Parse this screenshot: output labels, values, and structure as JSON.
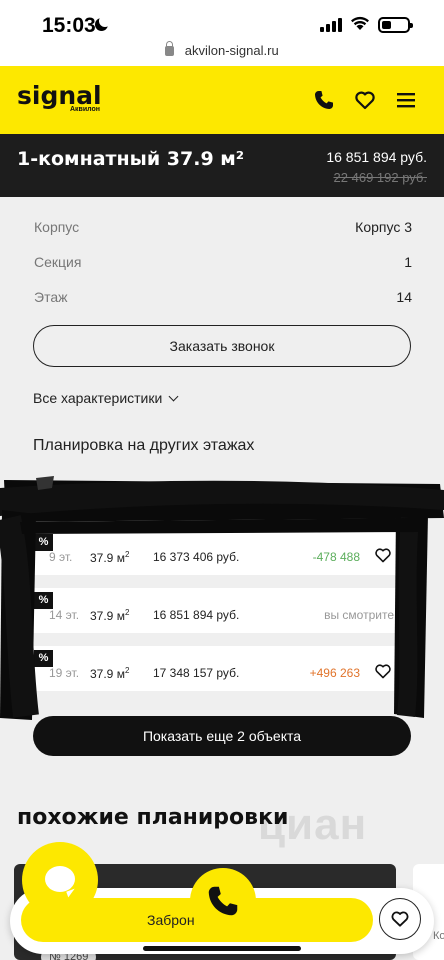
{
  "status_bar": {
    "time": "15:03"
  },
  "browser": {
    "url": "akvilon-signal.ru"
  },
  "header": {
    "logo": "signal",
    "logo_sub": "Аквилон"
  },
  "listing": {
    "title": "1-комнатный 37.9 м²",
    "price": "16 851 894 руб.",
    "old_price": "22 469 192 руб."
  },
  "properties": [
    {
      "label": "Корпус",
      "value": "Корпус 3"
    },
    {
      "label": "Секция",
      "value": "1"
    },
    {
      "label": "Этаж",
      "value": "14"
    }
  ],
  "actions": {
    "call_label": "Заказать звонок",
    "all_chars_label": "Все характеристики",
    "show_more_label": "Показать еще 2 объекта",
    "book_label": "Заброн"
  },
  "other_floors": {
    "title": "Планировка на других этажах",
    "rows": [
      {
        "floor": "9 эт.",
        "area": "37.9 м",
        "area_sup": "2",
        "price": "16 373 406 руб.",
        "diff": "-478 488",
        "diff_type": "neg",
        "badge": "%"
      },
      {
        "floor": "14 эт.",
        "area": "37.9 м",
        "area_sup": "2",
        "price": "16 851 894 руб.",
        "diff": "вы смотрите",
        "diff_type": "cur",
        "badge": "%"
      },
      {
        "floor": "19 эт.",
        "area": "37.9 м",
        "area_sup": "2",
        "price": "17 348 157 руб.",
        "diff": "+496 263",
        "diff_type": "pos",
        "badge": "%"
      }
    ]
  },
  "similar": {
    "title": "похожие планировки",
    "watermark": "циан",
    "card_tag": "№ 1269",
    "card_light_text": "Ко"
  },
  "colors": {
    "brand_yellow": "#fde800",
    "dark": "#1d1d1d",
    "green": "#5cae5c",
    "orange": "#e1742b"
  }
}
